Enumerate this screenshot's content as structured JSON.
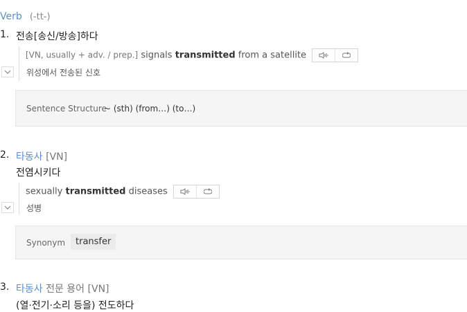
{
  "header": {
    "pos": "Verb",
    "form": "(-tt-)"
  },
  "senses": [
    {
      "number": "1.",
      "meaning": "전송[송신/방송]하다",
      "example": {
        "grammar": "[VN, usually + adv. / prep.]",
        "pre": "signals",
        "bold": "transmitted",
        "post": "from a satellite",
        "translation": "위성에서 전송된 신호"
      },
      "box": {
        "label": "Sentence Structure",
        "value": "~ (sth) (from…) (to…)"
      }
    },
    {
      "number": "2.",
      "pos": "타동사",
      "pattern": "[VN]",
      "meaning": "전염시키다",
      "example": {
        "pre": "sexually",
        "bold": "transmitted",
        "post": "diseases",
        "translation": "성병"
      },
      "box": {
        "label": "Synonym",
        "value": "transfer"
      }
    },
    {
      "number": "3.",
      "pos": "타동사",
      "field": "전문 용어",
      "pattern": "[VN]",
      "meaning": "(열·전기·소리 등을) 전도하다"
    }
  ],
  "icons": {
    "audio": "speaker-icon",
    "repeat": "repeat-icon",
    "toggle": "chevron-down-icon"
  }
}
